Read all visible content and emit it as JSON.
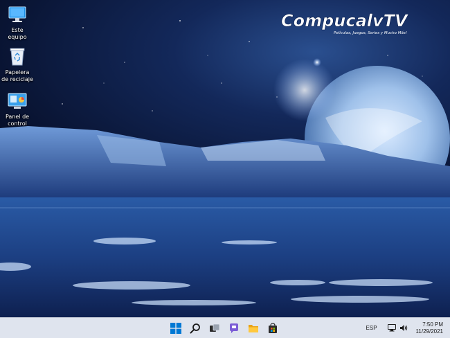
{
  "desktop": {
    "icons": [
      {
        "label": "Este equipo",
        "icon": "computer-icon"
      },
      {
        "label": "Papelera de reciclaje",
        "icon": "recycle-bin-icon"
      },
      {
        "label": "Panel de control",
        "icon": "control-panel-icon"
      }
    ]
  },
  "watermark": {
    "brand": "CompucalvTV",
    "tagline": "Películas, Juegos, Series y Mucho Más!"
  },
  "taskbar": {
    "pinned": [
      "start-icon",
      "search-icon",
      "task-view-icon",
      "chat-icon",
      "file-explorer-icon",
      "store-icon"
    ],
    "tray": {
      "language": "ESP",
      "time": "7:50 PM",
      "date": "11/29/2021"
    }
  },
  "colors": {
    "taskbar_bg": "#dfe4ee",
    "accent": "#0078d4",
    "sky": "#06112e",
    "ice": "#2a5ba6"
  }
}
